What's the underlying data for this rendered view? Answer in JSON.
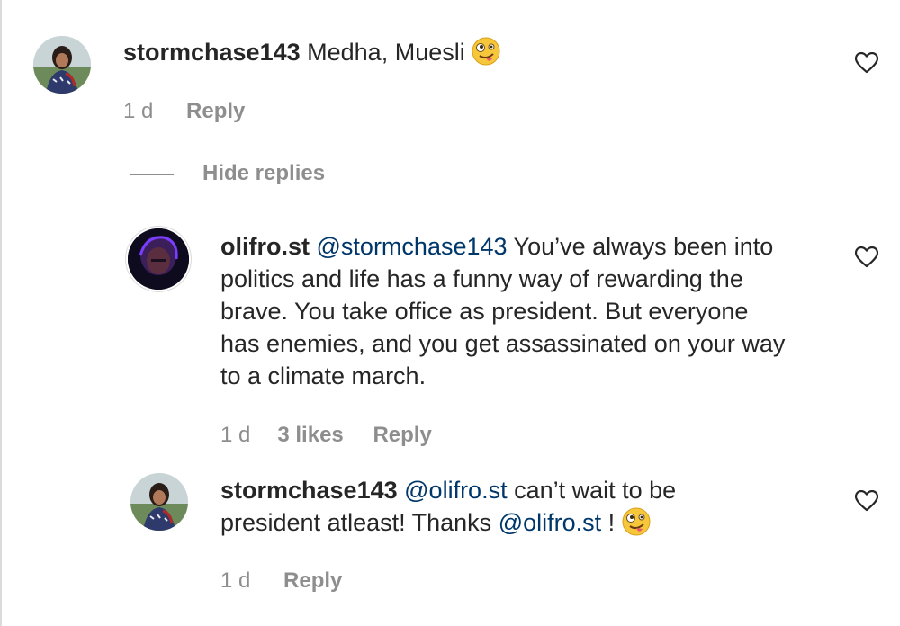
{
  "comments": [
    {
      "username": "stormchase143",
      "text": "Medha, Muesli",
      "emoji": "zany-face",
      "time": "1 d",
      "reply_label": "Reply"
    }
  ],
  "hide_replies_label": "Hide replies",
  "replies": [
    {
      "username": "olifro.st",
      "mention": "@stormchase143",
      "text_line1": " You’ve always been into",
      "text_line2": "politics and life has a funny way of rewarding the",
      "text_line3": "brave. You take office as president. But everyone",
      "text_line4": "has enemies, and you get assassinated on your way",
      "text_line5": "to a climate march.",
      "time": "1 d",
      "likes": "3 likes",
      "reply_label": "Reply"
    },
    {
      "username": "stormchase143",
      "mention": "@olifro.st",
      "text_line1": " can’t wait to be",
      "text_line2a": "president atleast! Thanks ",
      "mention2": "@olifro.st",
      "text_line2b": " !",
      "emoji": "zany-face",
      "time": "1 d",
      "reply_label": "Reply"
    }
  ],
  "colors": {
    "text": "#262626",
    "meta": "#8e8e8e",
    "mention": "#00376b"
  }
}
